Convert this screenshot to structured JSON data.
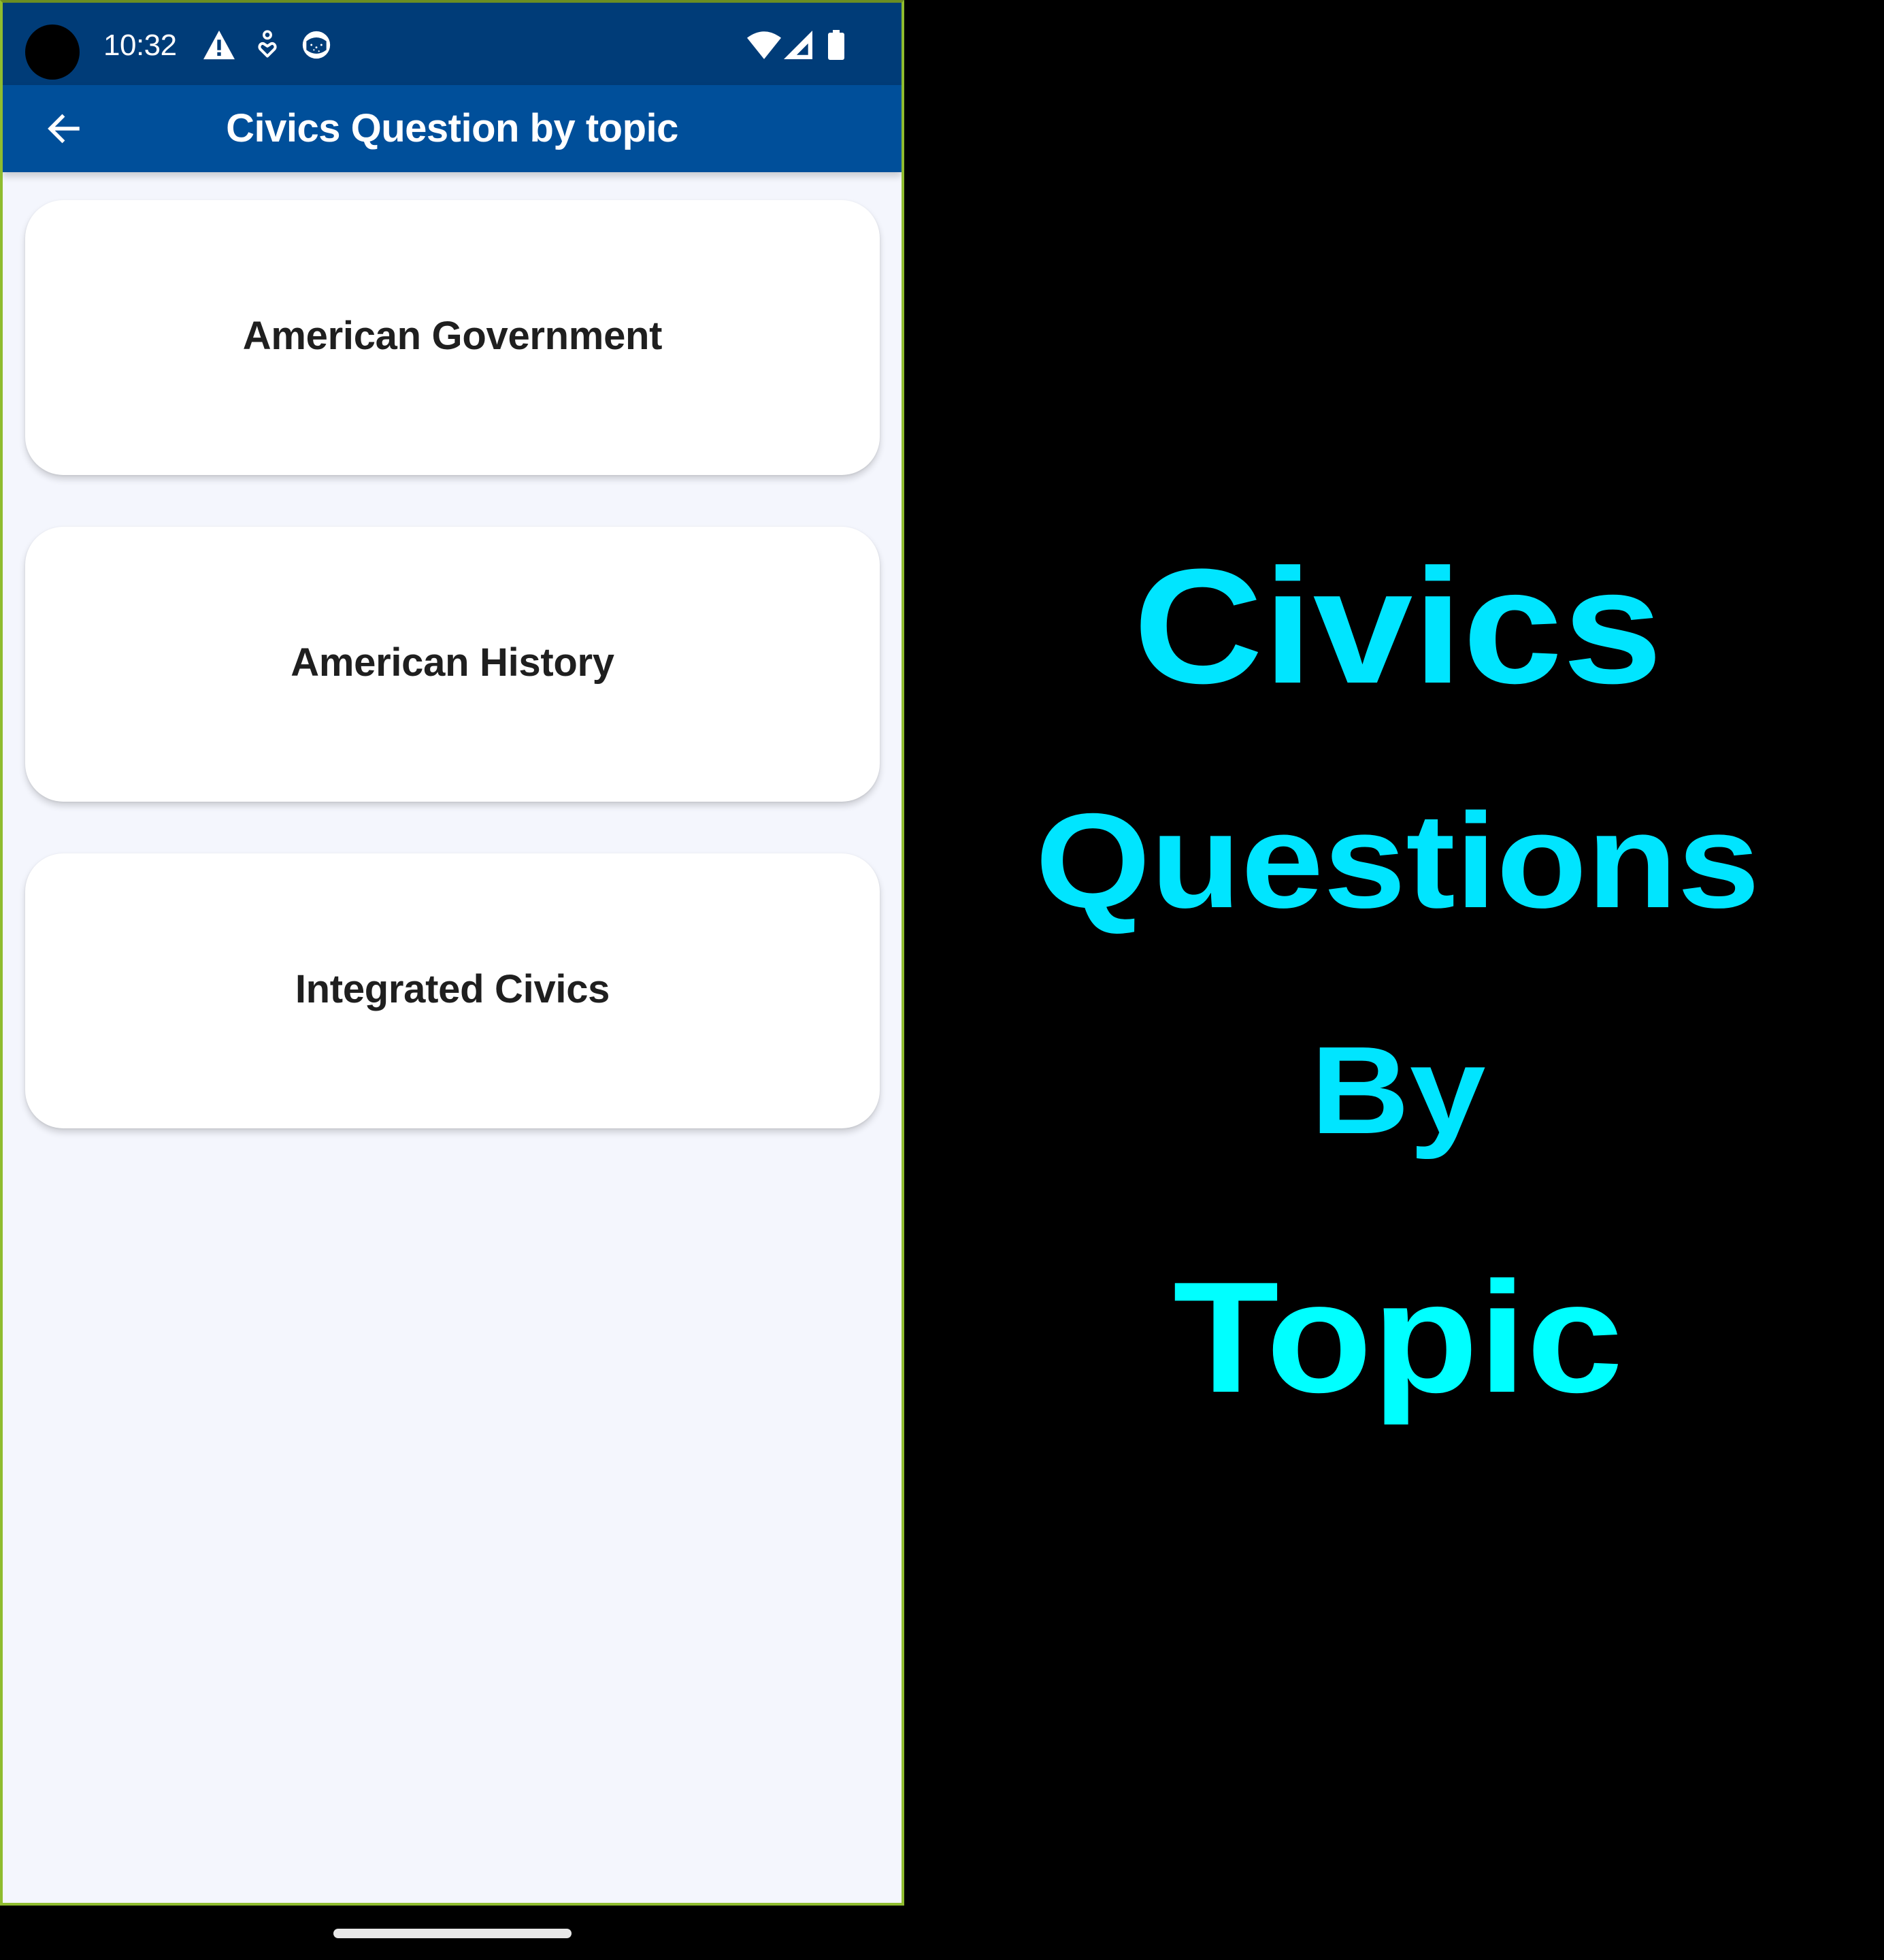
{
  "status_bar": {
    "time": "10:32",
    "left_icons": [
      "warning-icon",
      "accessibility-heart-icon",
      "face-icon"
    ],
    "right_icons": [
      "wifi-icon",
      "cell-signal-icon",
      "battery-icon"
    ]
  },
  "app_bar": {
    "back_icon": "arrow-back-icon",
    "title": "Civics Question by topic"
  },
  "topics": [
    {
      "label": "American Government"
    },
    {
      "label": "American History"
    },
    {
      "label": "Integrated Civics"
    }
  ],
  "promo": {
    "lines": [
      "Civics",
      "Questions",
      "By",
      "Topic"
    ],
    "colors": [
      "#00E5FF",
      "#00E5FF",
      "#00E5FF",
      "#00FFFF"
    ]
  },
  "theme": {
    "status_bar_color": "#003C78",
    "app_bar_color": "#004F9A",
    "background": "#F4F6FD",
    "card_text_color": "#1F1F1F"
  }
}
